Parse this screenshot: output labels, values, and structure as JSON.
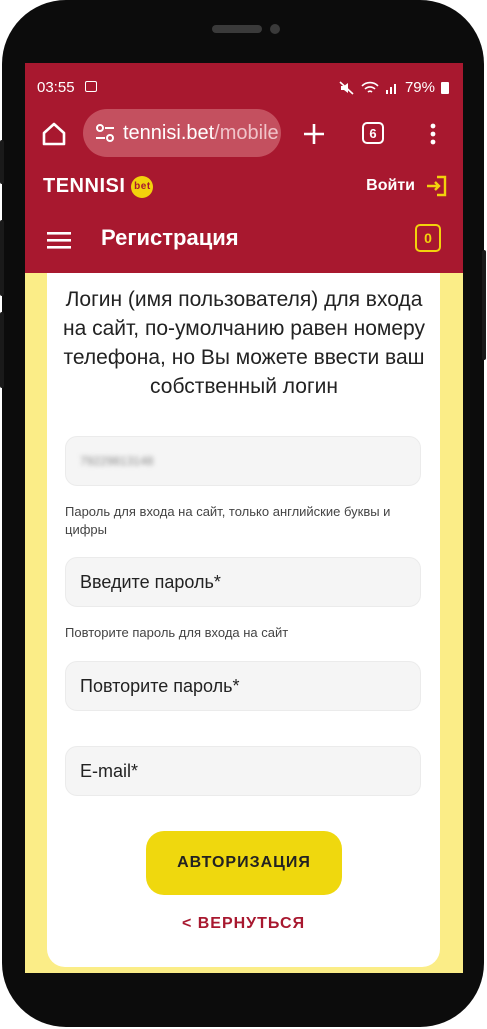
{
  "status": {
    "time": "03:55",
    "battery": "79%"
  },
  "browser": {
    "url_host": "tennisi.bet",
    "url_path": "/mobile",
    "tab_count": "6"
  },
  "header": {
    "logo_text": "TENNISI",
    "logo_badge": "bet",
    "login_label": "Войти",
    "page_title": "Регистрация",
    "betslip_count": "0"
  },
  "form": {
    "info_text": "Логин (имя пользователя) для входа на сайт, по-умолчанию равен номеру телефона, но Вы можете ввести ваш собственный логин",
    "login_value": "79229813148",
    "password_hint": "Пароль для входа на сайт, только английские буквы и цифры",
    "password_placeholder": "Введите пароль*",
    "repeat_hint": "Повторите пароль для входа на сайт",
    "repeat_placeholder": "Повторите пароль*",
    "email_placeholder": "E-mail*",
    "auth_button": "АВТОРИЗАЦИЯ",
    "back_link": "< ВЕРНУТЬСЯ"
  },
  "colors": {
    "brand_red": "#a8182f",
    "accent_yellow": "#efd80e",
    "background_yellow": "#fbed87"
  }
}
